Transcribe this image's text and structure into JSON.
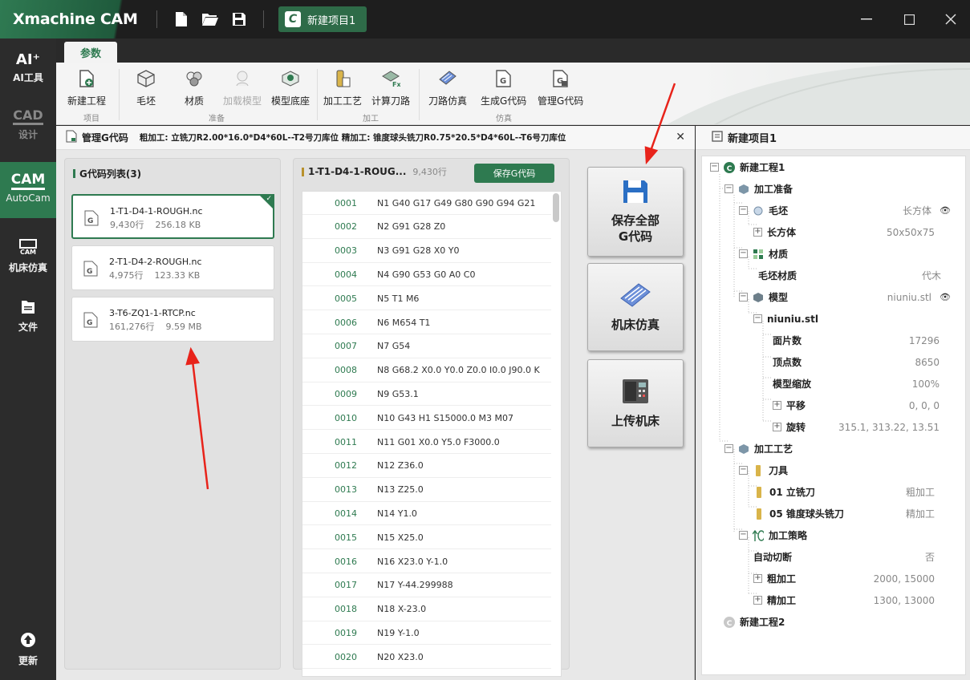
{
  "app": {
    "brand": "Xmachine CAM",
    "project_tab": "新建项目1",
    "project_tab_icon": "C"
  },
  "rail": {
    "ai": {
      "icon": "AI⁺",
      "label": "AI工具"
    },
    "cad": {
      "icon": "CAD",
      "label": "设计"
    },
    "cam": {
      "icon": "CAM",
      "label": "AutoCam"
    },
    "sim": {
      "icon": "CAM",
      "label": "机床仿真"
    },
    "file": {
      "label": "文件"
    },
    "update": {
      "label": "更新"
    }
  },
  "ribbon": {
    "tab": "参数",
    "buttons": {
      "new_project": "新建工程",
      "stock": "毛坯",
      "material": "材质",
      "load_model": "加载模型",
      "model_base": "模型底座",
      "process": "加工工艺",
      "calc_path": "计算刀路",
      "path_sim": "刀路仿真",
      "gen_gcode": "生成G代码",
      "manage_gcode": "管理G代码"
    },
    "groups": {
      "project": "项目",
      "prepare": "准备",
      "machining": "加工",
      "simulation": "仿真"
    }
  },
  "main": {
    "title": "管理G代码",
    "info": "粗加工: 立铣刀R2.00*16.0*D4*60L--T2号刀库位   精加工: 锥度球头铣刀R0.75*20.5*D4*60L--T6号刀库位",
    "list_title": "G代码列表(3)",
    "files": [
      {
        "name": "1-T1-D4-1-ROUGH.nc",
        "lines": "9,430行",
        "size": "256.18 KB"
      },
      {
        "name": "2-T1-D4-2-ROUGH.nc",
        "lines": "4,975行",
        "size": "123.33 KB"
      },
      {
        "name": "3-T6-ZQ1-1-RTCP.nc",
        "lines": "161,276行",
        "size": "9.59 MB"
      }
    ],
    "code_title": "1-T1-D4-1-ROUG...",
    "code_lines": "9,430行",
    "save_btn": "保存G代码",
    "code": [
      {
        "n": "0001",
        "t": "N1 G40 G17 G49 G80 G90 G94 G21"
      },
      {
        "n": "0002",
        "t": "N2 G91 G28 Z0"
      },
      {
        "n": "0003",
        "t": "N3 G91 G28 X0 Y0"
      },
      {
        "n": "0004",
        "t": "N4 G90 G53 G0 A0 C0"
      },
      {
        "n": "0005",
        "t": "N5 T1 M6"
      },
      {
        "n": "0006",
        "t": "N6 M654 T1"
      },
      {
        "n": "0007",
        "t": "N7 G54"
      },
      {
        "n": "0008",
        "t": "N8 G68.2 X0.0 Y0.0 Z0.0 I0.0 J90.0 K"
      },
      {
        "n": "0009",
        "t": "N9 G53.1"
      },
      {
        "n": "0010",
        "t": "N10 G43 H1 S15000.0 M3 M07"
      },
      {
        "n": "0011",
        "t": "N11 G01 X0.0 Y5.0 F3000.0"
      },
      {
        "n": "0012",
        "t": "N12 Z36.0"
      },
      {
        "n": "0013",
        "t": "N13 Z25.0"
      },
      {
        "n": "0014",
        "t": "N14 Y1.0"
      },
      {
        "n": "0015",
        "t": "N15 X25.0"
      },
      {
        "n": "0016",
        "t": "N16 X23.0 Y-1.0"
      },
      {
        "n": "0017",
        "t": "N17 Y-44.299988"
      },
      {
        "n": "0018",
        "t": "N18 X-23.0"
      },
      {
        "n": "0019",
        "t": "N19 Y-1.0"
      },
      {
        "n": "0020",
        "t": "N20 X23.0"
      }
    ],
    "save_all_1": "保存全部",
    "save_all_2": "G代码",
    "machine_sim": "机床仿真",
    "upload": "上传机床"
  },
  "tree": {
    "title": "新建项目1",
    "project1": "新建工程1",
    "prep": "加工准备",
    "stock": "毛坯",
    "stock_val": "长方体",
    "cuboid": "长方体",
    "cuboid_val": "50x50x75",
    "material": "材质",
    "stock_material": "毛坯材质",
    "stock_material_val": "代木",
    "model": "模型",
    "model_val": "niuniu.stl",
    "stl": "niuniu.stl",
    "faces": "面片数",
    "faces_val": "17296",
    "verts": "顶点数",
    "verts_val": "8650",
    "scale": "模型缩放",
    "scale_val": "100%",
    "translate": "平移",
    "translate_val": "0, 0, 0",
    "rotate": "旋转",
    "rotate_val": "315.1, 313.22, 13.51",
    "process": "加工工艺",
    "tools": "刀具",
    "tool1": "01 立铣刀",
    "tool1_val": "粗加工",
    "tool2": "05 锥度球头铣刀",
    "tool2_val": "精加工",
    "strategy": "加工策略",
    "auto_cut": "自动切断",
    "auto_cut_val": "否",
    "rough": "粗加工",
    "rough_val": "2000, 15000",
    "finish": "精加工",
    "finish_val": "1300, 13000",
    "project2": "新建工程2"
  },
  "colors": {
    "accent": "#2e7a50",
    "annotation": "#e8231a"
  }
}
